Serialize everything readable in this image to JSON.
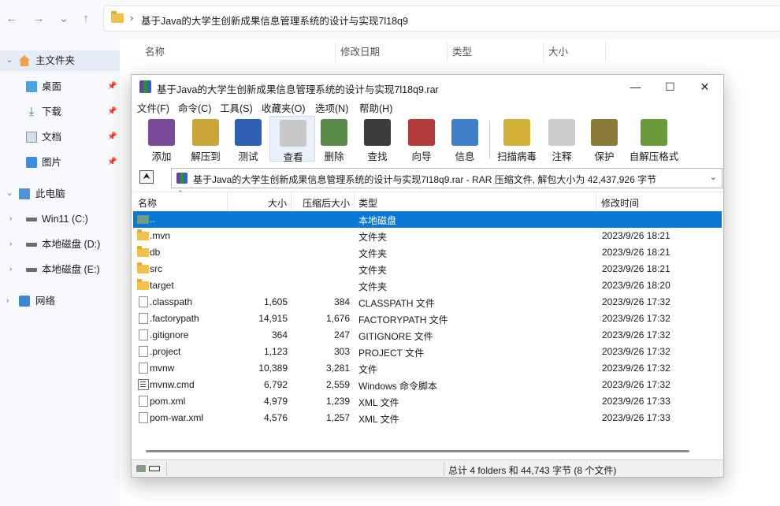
{
  "explorer": {
    "nav": {
      "back": "←",
      "forward": "→",
      "recent": "⌄",
      "up": "↑"
    },
    "address": {
      "separator": "›",
      "path": "基于Java的大学生创新成果信息管理系统的设计与实现7l18q9"
    },
    "sidebar": [
      {
        "label": "主文件夹",
        "icon": "home-icon",
        "chevron": "⌄",
        "selected": true
      },
      {
        "label": "桌面",
        "icon": "desktop-icon",
        "pinned": true
      },
      {
        "label": "下载",
        "icon": "download-icon",
        "pinned": true
      },
      {
        "label": "文档",
        "icon": "document-icon",
        "pinned": true
      },
      {
        "label": "图片",
        "icon": "pictures-icon",
        "pinned": true
      },
      {
        "label": "此电脑",
        "icon": "pc-icon",
        "chevron": "⌄"
      },
      {
        "label": "Win11 (C:)",
        "icon": "drive-icon",
        "chevron": "›"
      },
      {
        "label": "本地磁盘 (D:)",
        "icon": "drive-icon",
        "chevron": "›"
      },
      {
        "label": "本地磁盘 (E:)",
        "icon": "drive-icon",
        "chevron": "›"
      },
      {
        "label": "网络",
        "icon": "network-icon",
        "chevron": "›"
      }
    ],
    "columns": {
      "name": "名称",
      "modified": "修改日期",
      "type": "类型",
      "size": "大小"
    }
  },
  "winrar": {
    "title": "基于Java的大学生创新成果信息管理系统的设计与实现7l18q9.rar",
    "window_buttons": {
      "minimize": "—",
      "maximize": "☐",
      "close": "✕"
    },
    "menu": [
      "文件(F)",
      "命令(C)",
      "工具(S)",
      "收藏夹(O)",
      "选项(N)",
      "帮助(H)"
    ],
    "toolbar": [
      {
        "label": "添加",
        "icon": "add-icon",
        "color": "#7a4a9a"
      },
      {
        "label": "解压到",
        "icon": "extract-icon",
        "color": "#c9a53a"
      },
      {
        "label": "测试",
        "icon": "test-icon",
        "color": "#2e5fb0"
      },
      {
        "label": "查看",
        "icon": "view-icon",
        "color": "#c8c8c8",
        "active": true
      },
      {
        "label": "删除",
        "icon": "delete-icon",
        "color": "#5a8a4a"
      },
      {
        "label": "查找",
        "icon": "find-icon",
        "color": "#3b3b3b"
      },
      {
        "label": "向导",
        "icon": "wizard-icon",
        "color": "#b23a3a"
      },
      {
        "label": "信息",
        "icon": "info-icon",
        "color": "#3f7fc9"
      },
      {
        "label": "扫描病毒",
        "icon": "scan-icon",
        "color": "#d4b23a"
      },
      {
        "label": "注释",
        "icon": "comment-icon",
        "color": "#cccccc"
      },
      {
        "label": "保护",
        "icon": "protect-icon",
        "color": "#8a7a3a"
      },
      {
        "label": "自解压格式",
        "icon": "sfx-icon",
        "color": "#6a9a3a"
      }
    ],
    "up_button": "⮝",
    "path_bar": "基于Java的大学生创新成果信息管理系统的设计与实现7l18q9.rar - RAR 压缩文件, 解包大小为 42,437,926 字节",
    "path_dropdown": "⌄",
    "columns": {
      "name": "名称",
      "size": "大小",
      "packed": "压缩后大小",
      "type": "类型",
      "modified": "修改时间"
    },
    "sort_mark": "⌃",
    "files": [
      {
        "name": "..",
        "size": "",
        "packed": "",
        "type": "本地磁盘",
        "modified": "",
        "icon": "up-folder-icon",
        "selected": true
      },
      {
        "name": ".mvn",
        "size": "",
        "packed": "",
        "type": "文件夹",
        "modified": "2023/9/26 18:21",
        "icon": "folder-icon"
      },
      {
        "name": "db",
        "size": "",
        "packed": "",
        "type": "文件夹",
        "modified": "2023/9/26 18:21",
        "icon": "folder-icon"
      },
      {
        "name": "src",
        "size": "",
        "packed": "",
        "type": "文件夹",
        "modified": "2023/9/26 18:21",
        "icon": "folder-icon"
      },
      {
        "name": "target",
        "size": "",
        "packed": "",
        "type": "文件夹",
        "modified": "2023/9/26 18:20",
        "icon": "folder-icon"
      },
      {
        "name": ".classpath",
        "size": "1,605",
        "packed": "384",
        "type": "CLASSPATH 文件",
        "modified": "2023/9/26 17:32",
        "icon": "file-icon"
      },
      {
        "name": ".factorypath",
        "size": "14,915",
        "packed": "1,676",
        "type": "FACTORYPATH 文件",
        "modified": "2023/9/26 17:32",
        "icon": "file-icon"
      },
      {
        "name": ".gitignore",
        "size": "364",
        "packed": "247",
        "type": "GITIGNORE 文件",
        "modified": "2023/9/26 17:32",
        "icon": "file-icon"
      },
      {
        "name": ".project",
        "size": "1,123",
        "packed": "303",
        "type": "PROJECT 文件",
        "modified": "2023/9/26 17:32",
        "icon": "file-icon"
      },
      {
        "name": "mvnw",
        "size": "10,389",
        "packed": "3,281",
        "type": "文件",
        "modified": "2023/9/26 17:32",
        "icon": "file-icon"
      },
      {
        "name": "mvnw.cmd",
        "size": "6,792",
        "packed": "2,559",
        "type": "Windows 命令脚本",
        "modified": "2023/9/26 17:32",
        "icon": "cmd-icon"
      },
      {
        "name": "pom.xml",
        "size": "4,979",
        "packed": "1,239",
        "type": "XML 文件",
        "modified": "2023/9/26 17:33",
        "icon": "file-icon"
      },
      {
        "name": "pom-war.xml",
        "size": "4,576",
        "packed": "1,257",
        "type": "XML 文件",
        "modified": "2023/9/26 17:33",
        "icon": "file-icon"
      }
    ],
    "status": "总计 4 folders 和 44,743 字节 (8 个文件)"
  }
}
